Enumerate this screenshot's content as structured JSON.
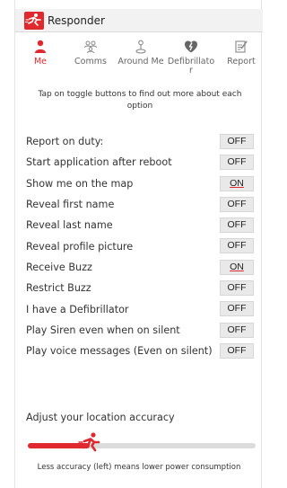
{
  "app": {
    "title": "Responder"
  },
  "nav": {
    "tabs": [
      {
        "label": "Me",
        "icon": "person-icon",
        "active": true
      },
      {
        "label": "Comms",
        "icon": "people-icon",
        "active": false
      },
      {
        "label": "Around Me",
        "icon": "location-pin-icon",
        "active": false
      },
      {
        "label": "Defibrillator",
        "icon": "heart-defibrillator-icon",
        "active": false
      },
      {
        "label": "Report",
        "icon": "report-icon",
        "active": false
      }
    ]
  },
  "hint": "Tap on toggle buttons to find out more about each option",
  "settings": [
    {
      "label": "Report on duty:",
      "state": "OFF"
    },
    {
      "label": "Start application after reboot",
      "state": "OFF"
    },
    {
      "label": "Show me on the map",
      "state": "ON"
    },
    {
      "label": "Reveal first name",
      "state": "OFF"
    },
    {
      "label": "Reveal last name",
      "state": "OFF"
    },
    {
      "label": "Reveal profile picture",
      "state": "OFF"
    },
    {
      "label": "Receive Buzz",
      "state": "ON"
    },
    {
      "label": "Restrict Buzz",
      "state": "OFF"
    },
    {
      "label": "I have a Defibrillator",
      "state": "OFF"
    },
    {
      "label": "Play Siren even when on silent",
      "state": "OFF"
    },
    {
      "label": "Play voice messages (Even on silent)",
      "state": "OFF"
    }
  ],
  "accuracy": {
    "label": "Adjust your location accuracy",
    "level": 0.27,
    "note": "Less accuracy (left) means lower power consumption"
  },
  "colors": {
    "accent": "#e0292e",
    "track": "#dcdcdc"
  }
}
